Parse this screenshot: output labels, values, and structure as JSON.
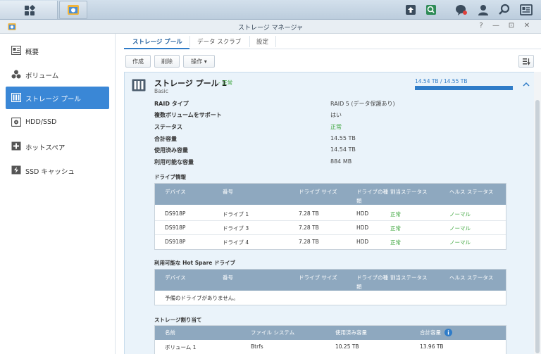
{
  "window": {
    "title": "ストレージ マネージャ",
    "controls": [
      "?",
      "—",
      "⊡",
      "✕"
    ]
  },
  "taskbar": {
    "left_icons": [
      "main-menu-icon",
      "storage-manager-app-icon"
    ],
    "right_icons": [
      "upload-icon",
      "search-app-icon",
      "notifications-icon",
      "user-icon",
      "search-icon",
      "widgets-icon"
    ]
  },
  "sidebar": {
    "items": [
      {
        "label": "概要",
        "icon": "overview-icon"
      },
      {
        "label": "ボリューム",
        "icon": "volume-icon"
      },
      {
        "label": "ストレージ プール",
        "icon": "storage-pool-icon",
        "active": true
      },
      {
        "label": "HDD/SSD",
        "icon": "hdd-icon"
      },
      {
        "label": "ホットスペア",
        "icon": "hot-spare-icon"
      },
      {
        "label": "SSD キャッシュ",
        "icon": "ssd-cache-icon"
      }
    ]
  },
  "tabs": [
    {
      "label": "ストレージ プール",
      "active": true
    },
    {
      "label": "データ スクラブ"
    },
    {
      "label": "設定"
    }
  ],
  "toolbar": {
    "create": "作成",
    "delete": "削除",
    "action": "操作 ▾"
  },
  "pool": {
    "name": "ストレージ プール 1",
    "status_separator": "-",
    "status": "正常",
    "type": "Basic",
    "capacity_text": "14.54 TB / 14.55 TB",
    "usage_fraction": 0.999,
    "details": [
      {
        "key": "RAID タイプ",
        "value": "RAID 5 (データ保護あり)"
      },
      {
        "key": "複数ボリュームをサポート",
        "value": "はい"
      },
      {
        "key": "ステータス",
        "value": "正常",
        "ok": true
      },
      {
        "key": "合計容量",
        "value": "14.55 TB"
      },
      {
        "key": "使用済み容量",
        "value": "14.54 TB"
      },
      {
        "key": "利用可能な容量",
        "value": "884 MB"
      }
    ]
  },
  "drive_info": {
    "title": "ドライブ情報",
    "headers": [
      "デバイス",
      "番号",
      "ドライブ サイズ",
      "ドライブの種\n類",
      "割当ステータス",
      "ヘルス ステータス"
    ],
    "rows": [
      [
        "DS918P",
        "ドライブ 1",
        "7.28 TB",
        "HDD",
        "正常",
        "ノーマル"
      ],
      [
        "DS918P",
        "ドライブ 3",
        "7.28 TB",
        "HDD",
        "正常",
        "ノーマル"
      ],
      [
        "DS918P",
        "ドライブ 4",
        "7.28 TB",
        "HDD",
        "正常",
        "ノーマル"
      ]
    ]
  },
  "hot_spare": {
    "title": "利用可能な Hot Spare ドライブ",
    "headers": [
      "デバイス",
      "番号",
      "ドライブ サイズ",
      "ドライブの種\n類",
      "割当ステータス",
      "ヘルス ステータス"
    ],
    "empty_text": "予備のドライブがありません。"
  },
  "allocation": {
    "title": "ストレージ割り当て",
    "headers": [
      "名前",
      "ファイル システム",
      "使用済み容量",
      "合計容量"
    ],
    "rows": [
      [
        "ボリューム 1",
        "Btrfs",
        "10.25 TB",
        "13.96 TB"
      ]
    ]
  },
  "colors": {
    "accent": "#3a87d6",
    "ok": "#3aa43a",
    "table_header": "#8ea8bf"
  }
}
